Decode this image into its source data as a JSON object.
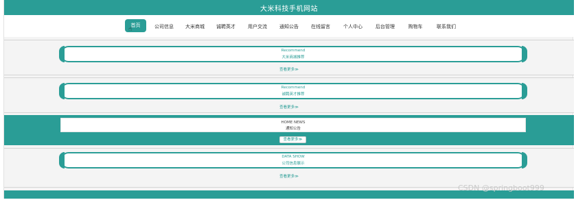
{
  "site": {
    "title": "大米科技手机网站"
  },
  "nav": {
    "items": [
      {
        "label": "首页"
      },
      {
        "label": "公司信息"
      },
      {
        "label": "大米商城"
      },
      {
        "label": "诚聘英才"
      },
      {
        "label": "用户交流"
      },
      {
        "label": "通知公告"
      },
      {
        "label": "在线留言"
      },
      {
        "label": "个人中心"
      },
      {
        "label": "后台管理"
      },
      {
        "label": "购物车"
      },
      {
        "label": "联系我们"
      }
    ],
    "active_index": 0
  },
  "sections": [
    {
      "en": "Recommend",
      "cn": "大米商城推荐",
      "more": "查看更多≫"
    },
    {
      "en": "Recommend",
      "cn": "诚聘英才推荐",
      "more": "查看更多≫"
    },
    {
      "en": "HOME NEWS",
      "cn": "通知公告",
      "more": "查看更多≫"
    },
    {
      "en": "DATA SHOW",
      "cn": "公司信息展示",
      "more": "查看更多≫"
    }
  ],
  "watermark": "CSDN @springboot999",
  "colors": {
    "accent": "#2a9d96",
    "background": "#f4f4f4"
  }
}
